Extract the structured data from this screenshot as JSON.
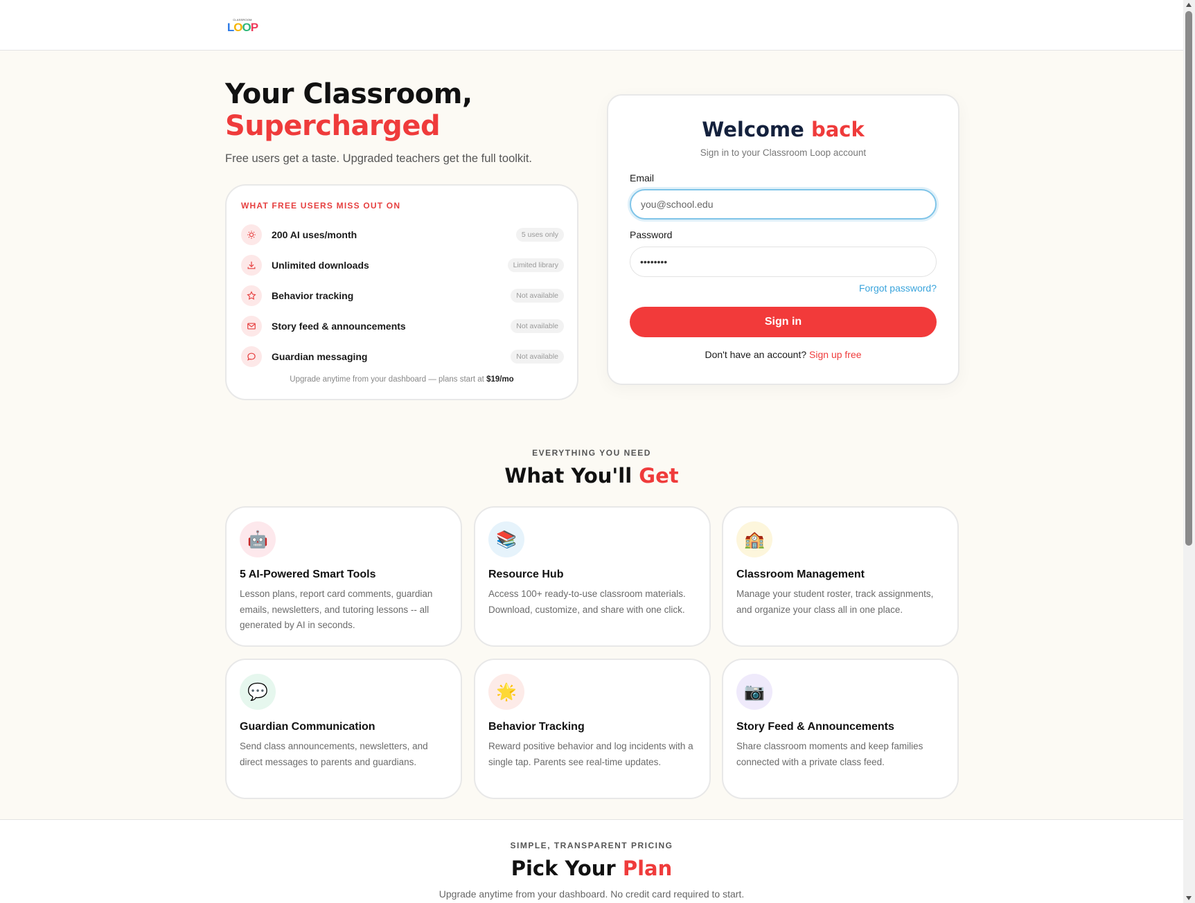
{
  "brand": {
    "logo_small": "CLASSROOM",
    "logo_letters": [
      "L",
      "O",
      "O",
      "P"
    ]
  },
  "colors": {
    "accent": "#ef3b3b",
    "link": "#3aa4dc",
    "page_bg": "#fcfaf4"
  },
  "hero": {
    "title_line1": "Your Classroom,",
    "title_line2": "Supercharged",
    "subtitle": "Free users get a taste. Upgraded teachers get the full toolkit."
  },
  "missing": {
    "heading": "WHAT FREE USERS MISS OUT ON",
    "items": [
      {
        "icon": "lightbulb-icon",
        "label": "200 AI uses/month",
        "badge": "5 uses only"
      },
      {
        "icon": "download-icon",
        "label": "Unlimited downloads",
        "badge": "Limited library"
      },
      {
        "icon": "star-icon",
        "label": "Behavior tracking",
        "badge": "Not available"
      },
      {
        "icon": "envelope-icon",
        "label": "Story feed & announcements",
        "badge": "Not available"
      },
      {
        "icon": "chat-bubble-icon",
        "label": "Guardian messaging",
        "badge": "Not available"
      }
    ],
    "footer_text": "Upgrade anytime from your dashboard — plans start at ",
    "footer_price": "$19/mo"
  },
  "login": {
    "title_part1": "Welcome",
    "title_part2": "back",
    "subtitle": "Sign in to your Classroom Loop account",
    "email_label": "Email",
    "email_placeholder": "you@school.edu",
    "password_label": "Password",
    "password_value": "••••••••",
    "forgot": "Forgot password?",
    "submit": "Sign in",
    "no_account": "Don't have an account?",
    "signup": "Sign up free"
  },
  "features_section": {
    "eyebrow": "EVERYTHING YOU NEED",
    "title_part1": "What You'll",
    "title_part2": "Get",
    "cards": [
      {
        "icon": "robot-icon",
        "emoji": "🤖",
        "title": "5 AI-Powered Smart Tools",
        "desc": "Lesson plans, report card comments, guardian emails, newsletters, and tutoring lessons -- all generated by AI in seconds."
      },
      {
        "icon": "books-icon",
        "emoji": "📚",
        "title": "Resource Hub",
        "desc": "Access 100+ ready-to-use classroom materials. Download, customize, and share with one click."
      },
      {
        "icon": "school-icon",
        "emoji": "🏫",
        "title": "Classroom Management",
        "desc": "Manage your student roster, track assignments, and organize your class all in one place."
      },
      {
        "icon": "speech-bubble-icon",
        "emoji": "💬",
        "title": "Guardian Communication",
        "desc": "Send class announcements, newsletters, and direct messages to parents and guardians."
      },
      {
        "icon": "star-burst-icon",
        "emoji": "🌟",
        "title": "Behavior Tracking",
        "desc": "Reward positive behavior and log incidents with a single tap. Parents see real-time updates."
      },
      {
        "icon": "camera-icon",
        "emoji": "📷",
        "title": "Story Feed & Announcements",
        "desc": "Share classroom moments and keep families connected with a private class feed."
      }
    ]
  },
  "pricing": {
    "eyebrow": "SIMPLE, TRANSPARENT PRICING",
    "title_part1": "Pick Your",
    "title_part2": "Plan",
    "subtitle": "Upgrade anytime from your dashboard. No credit card required to start."
  }
}
